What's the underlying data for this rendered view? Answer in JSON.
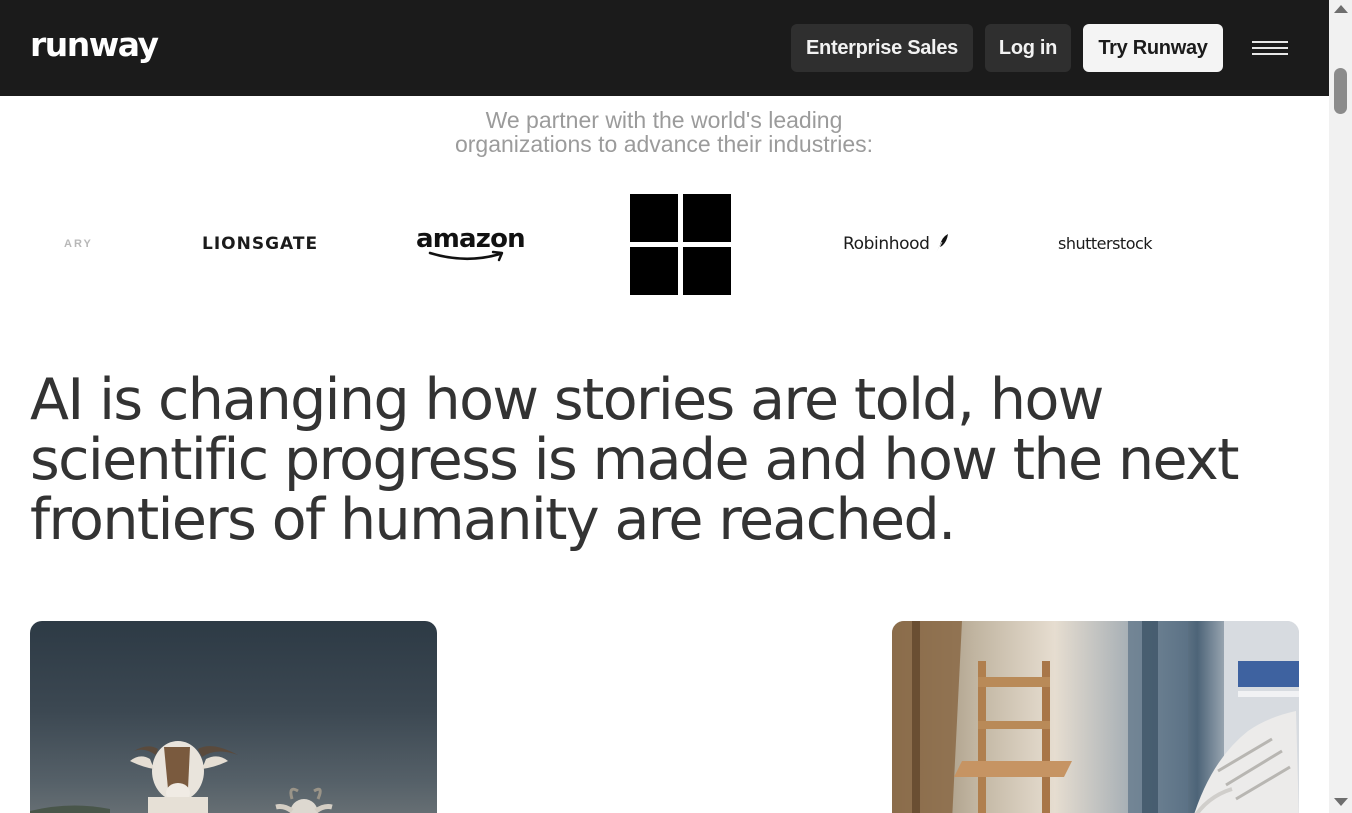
{
  "header": {
    "logo": "runway",
    "enterprise_label": "Enterprise Sales",
    "login_label": "Log in",
    "try_label": "Try Runway",
    "menu_icon": "hamburger-menu-icon"
  },
  "partners": {
    "intro_line1": "We partner with the world's leading",
    "intro_line2": "organizations to advance their industries:",
    "logos": {
      "cut_off": "ARY",
      "lionsgate": "LIONSGATE",
      "amazon": "amazon",
      "windows": "windows-logo",
      "robinhood": "Robinhood",
      "shutterstock": "shutterstock"
    }
  },
  "headline": {
    "line1": "AI is changing how stories are told, how",
    "line2": "scientific progress is made and how the next",
    "line3": "frontiers of humanity are reached."
  },
  "cards": [
    {
      "subject": "goats"
    },
    {
      "subject": "room-with-chair-and-sneaker"
    }
  ],
  "colors": {
    "header_bg": "#1b1b1b",
    "button_dark": "#2f2f2f",
    "button_light": "#f4f4f4",
    "headline_text": "#333333",
    "muted_text": "#9b9b9b"
  }
}
